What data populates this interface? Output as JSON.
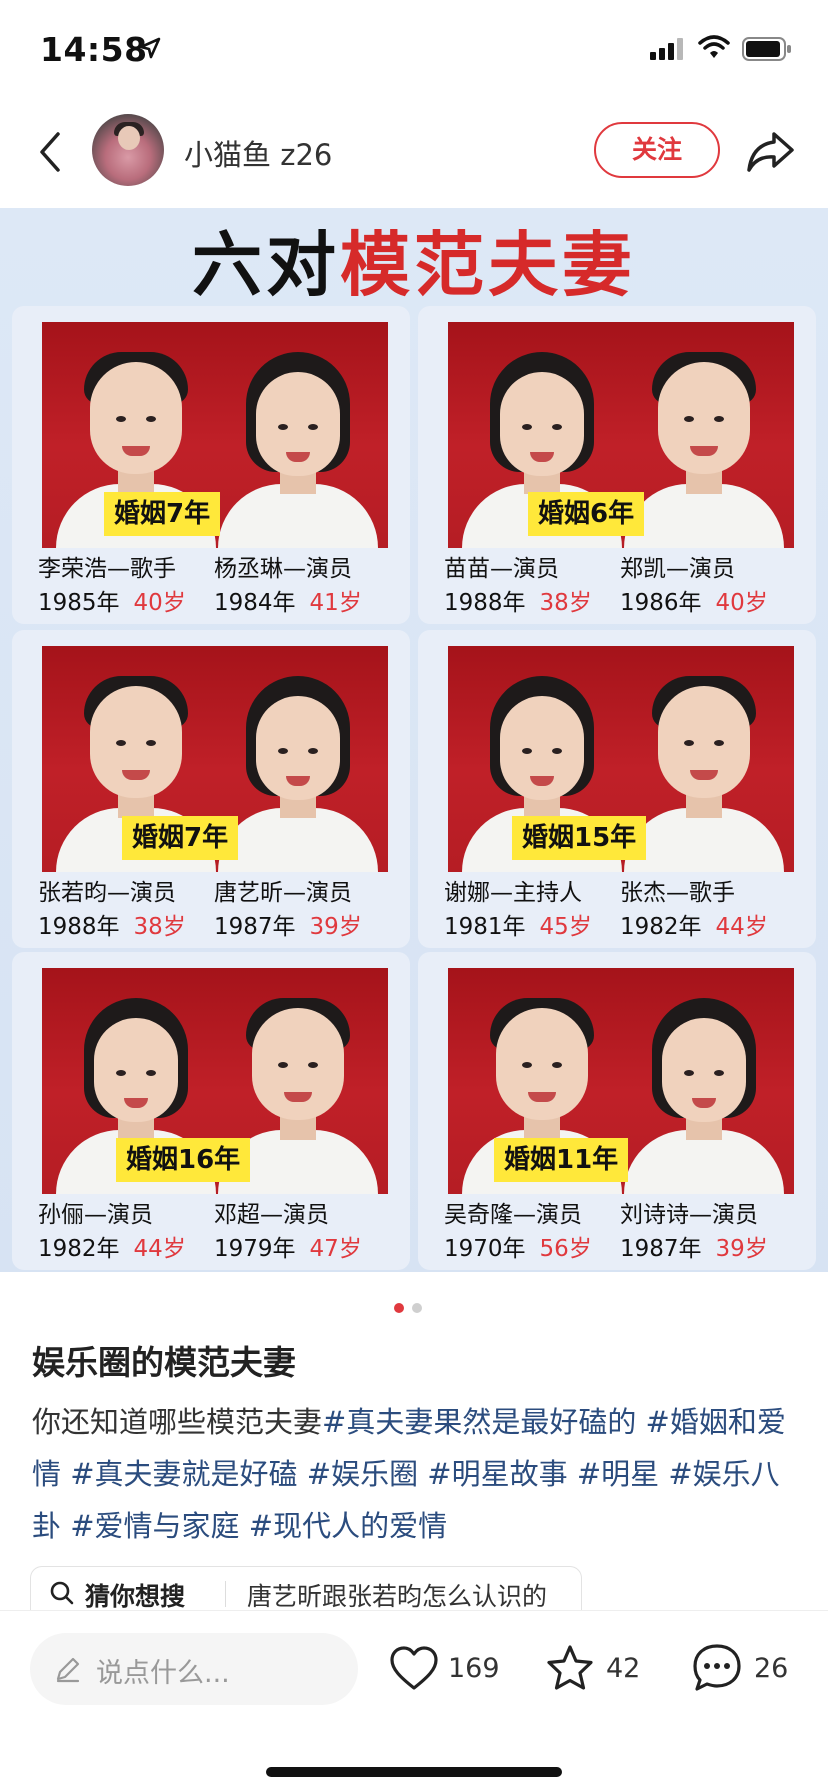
{
  "status_bar": {
    "time": "14:58"
  },
  "header": {
    "username": "小猫鱼 z26",
    "follow_label": "关注"
  },
  "poster": {
    "title_black": "六对",
    "title_red": "模范夫妻",
    "couples": [
      {
        "badge": "婚姻7年",
        "left": {
          "role": "李荣浩—歌手",
          "year": "1985年",
          "age": "40岁"
        },
        "right": {
          "role": "杨丞琳—演员",
          "year": "1984年",
          "age": "41岁"
        }
      },
      {
        "badge": "婚姻6年",
        "left": {
          "role": "苗苗—演员",
          "year": "1988年",
          "age": "38岁"
        },
        "right": {
          "role": "郑凯—演员",
          "year": "1986年",
          "age": "40岁"
        }
      },
      {
        "badge": "婚姻7年",
        "left": {
          "role": "张若昀—演员",
          "year": "1988年",
          "age": "38岁"
        },
        "right": {
          "role": "唐艺昕—演员",
          "year": "1987年",
          "age": "39岁"
        }
      },
      {
        "badge": "婚姻15年",
        "left": {
          "role": "谢娜—主持人",
          "year": "1981年",
          "age": "45岁"
        },
        "right": {
          "role": "张杰—歌手",
          "year": "1982年",
          "age": "44岁"
        }
      },
      {
        "badge": "婚姻16年",
        "left": {
          "role": "孙俪—演员",
          "year": "1982年",
          "age": "44岁"
        },
        "right": {
          "role": "邓超—演员",
          "year": "1979年",
          "age": "47岁"
        }
      },
      {
        "badge": "婚姻11年",
        "left": {
          "role": "吴奇隆—演员",
          "year": "1970年",
          "age": "56岁"
        },
        "right": {
          "role": "刘诗诗—演员",
          "year": "1987年",
          "age": "39岁"
        }
      }
    ]
  },
  "pager": {
    "current": 1,
    "total": 2
  },
  "post": {
    "title": "娱乐圈的模范夫妻",
    "body_text": "你还知道哪些模范夫妻",
    "tags": [
      "#真夫妻果然是最好磕的",
      "#婚姻和爱情",
      "#真夫妻就是好磕",
      "#娱乐圈",
      "#明星故事",
      "#明星",
      "#娱乐八卦",
      "#爱情与家庭",
      "#现代人的爱情"
    ],
    "guess_label": "猜你想搜",
    "guess_query": "唐艺昕跟张若昀怎么认识的"
  },
  "bottom_bar": {
    "comment_placeholder": "说点什么...",
    "likes": "169",
    "favorites": "42",
    "comments": "26"
  },
  "colors": {
    "accent_red": "#e0393e",
    "tag_blue": "#2b4c7e",
    "badge_yellow": "#ffe83a",
    "poster_bg": "#dde8f6"
  }
}
